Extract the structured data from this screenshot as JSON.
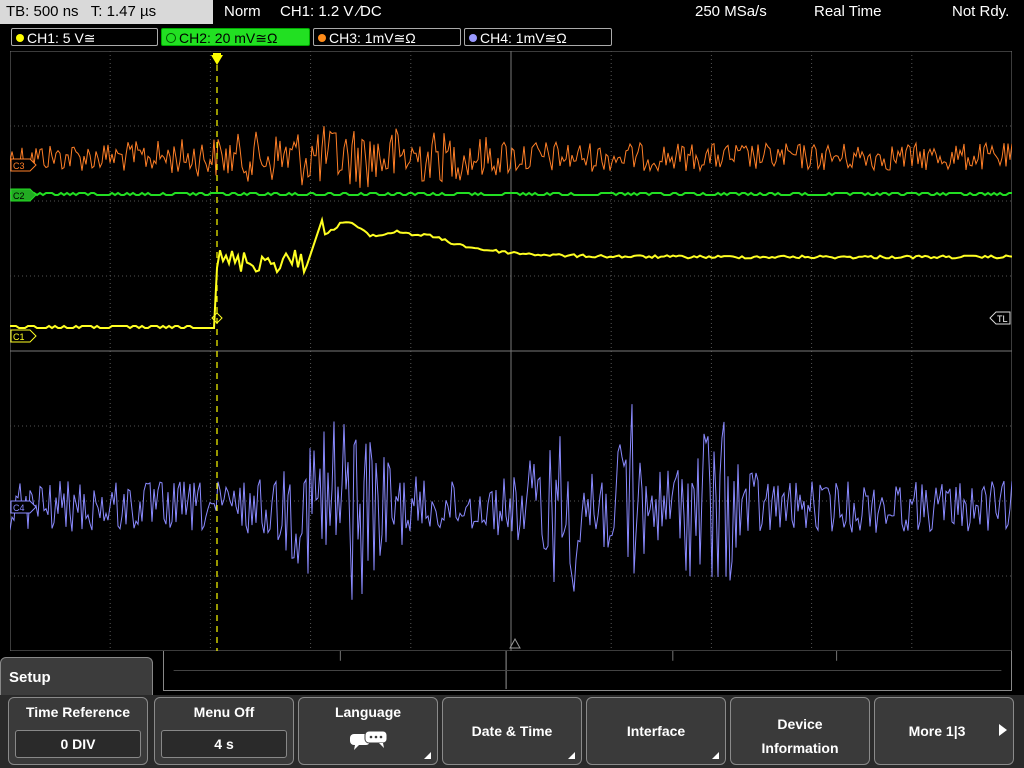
{
  "status_bar": {
    "timebase": "TB: 500 ns",
    "trigger_time": "T: 1.47 µs",
    "mode": "Norm",
    "trigger_info": "CH1: 1.2 V ∕DC",
    "sample_rate": "250 MSa/s",
    "acq_mode": "Real Time",
    "status": "Not Rdy."
  },
  "channels": [
    {
      "label": "CH1: 5 V≅",
      "color": "#ffff00",
      "active": false
    },
    {
      "label": "CH2: 20 mV≅Ω",
      "color": "#22e022",
      "active": true
    },
    {
      "label": "CH3: 1mV≅Ω",
      "color": "#ff8c1a",
      "active": false
    },
    {
      "label": "CH4: 1mV≅Ω",
      "color": "#9999ff",
      "active": false
    }
  ],
  "markers": {
    "c3": "C3",
    "c2": "C2",
    "c1": "C1",
    "c4": "C4",
    "trigger_level": "TL"
  },
  "waveform_colors": {
    "ch1": "#ffff22",
    "ch2": "#22dd22",
    "ch3": "#ff7f27",
    "ch4": "#8a8aff",
    "grid": "#555555",
    "trigger_line": "#ffff00"
  },
  "menu": {
    "title": "Setup",
    "buttons": [
      {
        "label": "Time Reference",
        "value": "0 DIV"
      },
      {
        "label": "Menu Off",
        "value": "4 s"
      },
      {
        "label": "Language",
        "value": ""
      },
      {
        "label": "Date & Time",
        "value": ""
      },
      {
        "label": "Interface",
        "value": ""
      },
      {
        "label": "Device Information",
        "value": ""
      },
      {
        "label": "More 1|3",
        "value": ""
      }
    ]
  }
}
